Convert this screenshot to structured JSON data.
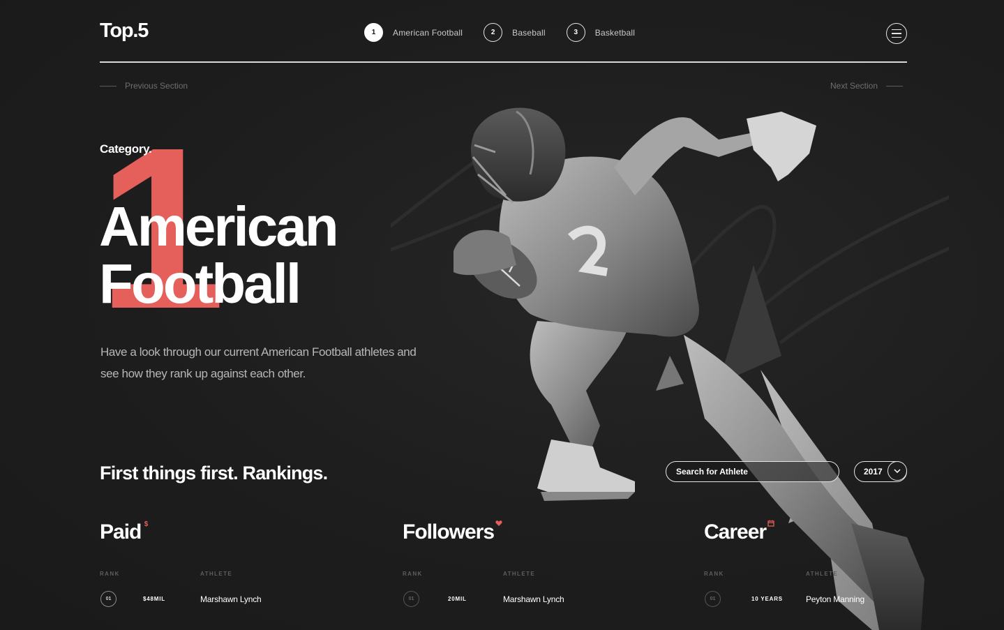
{
  "brand": {
    "logo": "Top.5"
  },
  "steps": [
    {
      "num": "1",
      "label": "American Football"
    },
    {
      "num": "2",
      "label": "Baseball"
    },
    {
      "num": "3",
      "label": "Basketball"
    }
  ],
  "section_nav": {
    "previous": "Previous Section",
    "next": "Next Section"
  },
  "hero": {
    "category": "Category.",
    "number": "1",
    "title_line1": "American",
    "title_line2": "Football",
    "description": "Have a look through our current American Football athletes and see how they rank up against each other."
  },
  "rankings": {
    "heading": "First things first.  Rankings.",
    "search_placeholder": "Search for Athlete",
    "year": "2017",
    "columns": [
      {
        "title": "Paid",
        "icon": "dollar-icon",
        "rank_header": "RANK",
        "athlete_header": "ATHLETE",
        "rows": [
          {
            "rank": "01",
            "metric": "$48MIL",
            "athlete": "Marshawn Lynch"
          }
        ]
      },
      {
        "title": "Followers",
        "icon": "heart-icon",
        "rank_header": "RANK",
        "athlete_header": "ATHLETE",
        "rows": [
          {
            "rank": "01",
            "metric": "20MIL",
            "athlete": "Marshawn Lynch"
          }
        ]
      },
      {
        "title": "Career",
        "icon": "calendar-icon",
        "rank_header": "RANK",
        "athlete_header": "ATHLETE",
        "rows": [
          {
            "rank": "01",
            "metric": "10 YEARS",
            "athlete": "Peyton Manning"
          }
        ]
      }
    ]
  },
  "colors": {
    "background": "#1e1e1e",
    "accent": "#e5605a",
    "text": "#ffffff",
    "muted": "#b7b7b7"
  }
}
